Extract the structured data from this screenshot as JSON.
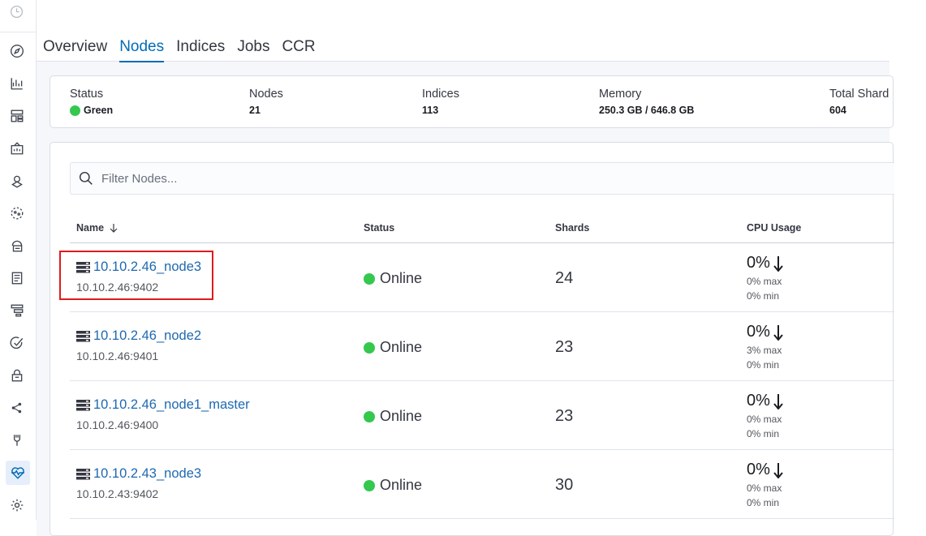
{
  "sidebar": {
    "icons": [
      "clock-icon",
      "compass-icon",
      "visualize-icon",
      "dashboard-icon",
      "canvas-icon",
      "maps-icon",
      "ml-icon",
      "infrastructure-icon",
      "logs-icon",
      "apm-icon",
      "uptime-icon",
      "siem-icon",
      "graph-icon",
      "devtools-icon",
      "monitoring-icon",
      "management-icon"
    ],
    "active": "monitoring-icon"
  },
  "tabs": [
    {
      "label": "Overview",
      "active": false
    },
    {
      "label": "Nodes",
      "active": true
    },
    {
      "label": "Indices",
      "active": false
    },
    {
      "label": "Jobs",
      "active": false
    },
    {
      "label": "CCR",
      "active": false
    }
  ],
  "summary": {
    "status_label": "Status",
    "status_value": "Green",
    "nodes_label": "Nodes",
    "nodes_value": "21",
    "indices_label": "Indices",
    "indices_value": "113",
    "memory_label": "Memory",
    "memory_value": "250.3 GB / 646.8 GB",
    "shards_label": "Total Shard",
    "shards_value": "604"
  },
  "search": {
    "placeholder": "Filter Nodes..."
  },
  "table": {
    "headers": {
      "name": "Name",
      "status": "Status",
      "shards": "Shards",
      "cpu": "CPU Usage"
    },
    "rows": [
      {
        "name": "10.10.2.46_node3",
        "address": "10.10.2.46:9402",
        "status": "Online",
        "shards": "24",
        "cpu": "0%",
        "cpu_max": "0% max",
        "cpu_min": "0% min"
      },
      {
        "name": "10.10.2.46_node2",
        "address": "10.10.2.46:9401",
        "status": "Online",
        "shards": "23",
        "cpu": "0%",
        "cpu_max": "3% max",
        "cpu_min": "0% min"
      },
      {
        "name": "10.10.2.46_node1_master",
        "address": "10.10.2.46:9400",
        "status": "Online",
        "shards": "23",
        "cpu": "0%",
        "cpu_max": "0% max",
        "cpu_min": "0% min"
      },
      {
        "name": "10.10.2.43_node3",
        "address": "10.10.2.43:9402",
        "status": "Online",
        "shards": "30",
        "cpu": "0%",
        "cpu_max": "0% max",
        "cpu_min": "0% min"
      }
    ]
  },
  "colors": {
    "link": "#1e68b0",
    "status_green": "#35c84f",
    "highlight": "#e01b1b",
    "tab_active": "#006bb8"
  }
}
